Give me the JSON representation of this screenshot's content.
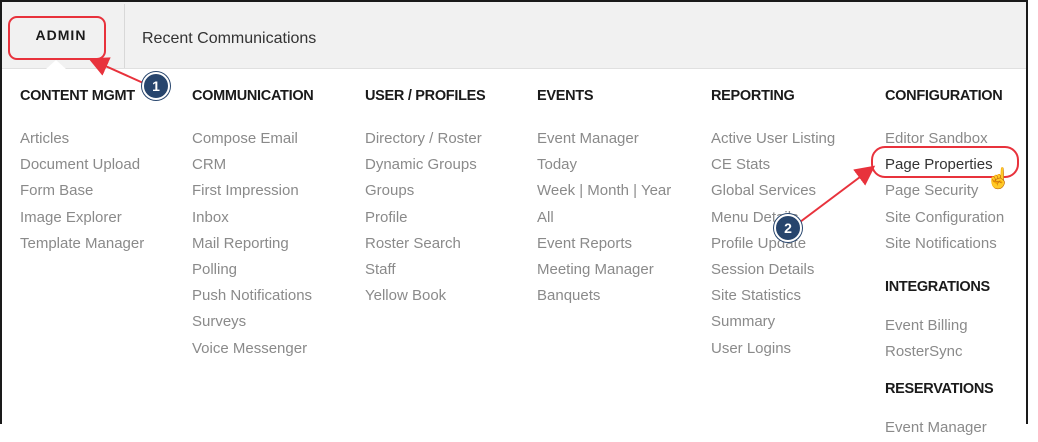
{
  "nav": {
    "admin_label": "ADMIN",
    "recent_label": "Recent Communications"
  },
  "columns": [
    {
      "heading": "CONTENT MGMT",
      "items": [
        "Articles",
        "Document Upload",
        "Form Base",
        "Image Explorer",
        "Template Manager"
      ]
    },
    {
      "heading": "COMMUNICATION",
      "items": [
        "Compose Email",
        "CRM",
        "First Impression",
        "Inbox",
        "Mail Reporting",
        "Polling",
        "Push Notifications",
        "Surveys",
        "Voice Messenger"
      ]
    },
    {
      "heading": "USER / PROFILES",
      "items": [
        "Directory / Roster",
        "Dynamic Groups",
        "Groups",
        "Profile",
        "Roster Search",
        "Staff",
        "Yellow Book"
      ]
    },
    {
      "heading": "EVENTS",
      "items": [
        "Event Manager",
        "Today",
        "Week | Month | Year",
        "All",
        "Event Reports",
        "Meeting Manager",
        "Banquets"
      ]
    },
    {
      "heading": "REPORTING",
      "items": [
        "Active User Listing",
        "CE Stats",
        "Global Services",
        "Menu Details",
        "Profile Update",
        "Session Details",
        "Site Statistics",
        "Summary",
        "User Logins"
      ]
    },
    {
      "heading": "CONFIGURATION",
      "items": [
        "Editor Sandbox",
        "Page Properties",
        "Page Security",
        "Site Configuration",
        "Site Notifications"
      ],
      "sub_sections": [
        {
          "heading": "INTEGRATIONS",
          "items": [
            "Event Billing",
            "RosterSync"
          ]
        },
        {
          "heading": "RESERVATIONS",
          "items": [
            "Event Manager"
          ]
        }
      ]
    }
  ],
  "callouts": {
    "marker_1": "1",
    "marker_2": "2",
    "accent_color": "#e8323c",
    "marker_color": "#27456d"
  }
}
